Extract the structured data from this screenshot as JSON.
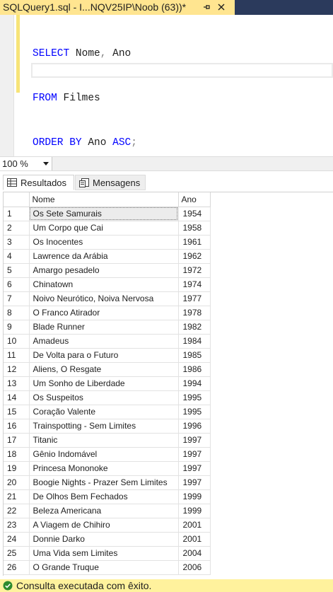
{
  "tab": {
    "title": "SQLQuery1.sql - I...NQV25IP\\Noob (63))*"
  },
  "editor": {
    "lines": [
      {
        "kw1": "SELECT",
        "rest1": " Nome",
        "p1": ",",
        "rest2": " Ano"
      },
      {
        "kw1": "FROM",
        "rest1": " Filmes"
      },
      {
        "kw1": "ORDER BY",
        "rest1": " Ano ",
        "kw2": "ASC",
        "p1": ";"
      }
    ]
  },
  "zoom": {
    "value": "100 %"
  },
  "results_tabs": {
    "results": "Resultados",
    "messages": "Mensagens"
  },
  "grid": {
    "columns": [
      "",
      "Nome",
      "Ano"
    ],
    "rows": [
      [
        "1",
        "Os Sete Samurais",
        "1954"
      ],
      [
        "2",
        "Um Corpo que Cai",
        "1958"
      ],
      [
        "3",
        "Os Inocentes",
        "1961"
      ],
      [
        "4",
        "Lawrence da Arábia",
        "1962"
      ],
      [
        "5",
        "Amargo pesadelo",
        "1972"
      ],
      [
        "6",
        "Chinatown",
        "1974"
      ],
      [
        "7",
        "Noivo Neurótico, Noiva Nervosa",
        "1977"
      ],
      [
        "8",
        "O Franco Atirador",
        "1978"
      ],
      [
        "9",
        "Blade Runner",
        "1982"
      ],
      [
        "10",
        "Amadeus",
        "1984"
      ],
      [
        "11",
        "De Volta para o Futuro",
        "1985"
      ],
      [
        "12",
        "Aliens, O Resgate",
        "1986"
      ],
      [
        "13",
        "Um Sonho de Liberdade",
        "1994"
      ],
      [
        "14",
        "Os Suspeitos",
        "1995"
      ],
      [
        "15",
        "Coração Valente",
        "1995"
      ],
      [
        "16",
        "Trainspotting - Sem Limites",
        "1996"
      ],
      [
        "17",
        "Titanic",
        "1997"
      ],
      [
        "18",
        "Gênio Indomável",
        "1997"
      ],
      [
        "19",
        "Princesa Mononoke",
        "1997"
      ],
      [
        "20",
        "Boogie Nights - Prazer Sem Limites",
        "1997"
      ],
      [
        "21",
        "De Olhos Bem Fechados",
        "1999"
      ],
      [
        "22",
        "Beleza Americana",
        "1999"
      ],
      [
        "23",
        "A Viagem de Chihiro",
        "2001"
      ],
      [
        "24",
        "Donnie Darko",
        "2001"
      ],
      [
        "25",
        "Uma Vida sem Limites",
        "2004"
      ],
      [
        "26",
        "O Grande Truque",
        "2006"
      ]
    ]
  },
  "status": {
    "text": "Consulta executada com êxito."
  },
  "colors": {
    "tab_active": "#ffe590",
    "tab_bar": "#2b3a5c",
    "keyword": "#0000ff",
    "status_bar": "#fff29d",
    "status_ok": "#2e8b2e"
  },
  "icons": {
    "pin": "pin-icon",
    "close": "close-icon",
    "results": "grid-icon",
    "messages": "messages-icon",
    "status": "check-circle-icon",
    "zoom": "chevron-down-icon"
  }
}
